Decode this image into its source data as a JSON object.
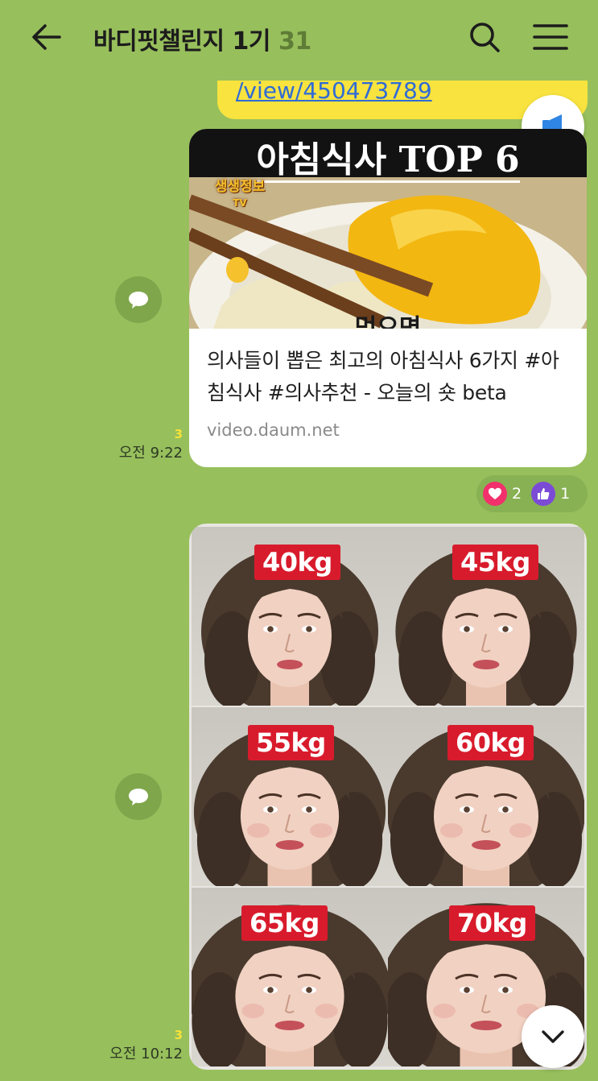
{
  "header": {
    "title": "바디핏챌린지 1기",
    "member_count": "31",
    "back_icon": "arrow-left-icon",
    "search_icon": "search-icon",
    "menu_icon": "hamburger-menu-icon"
  },
  "previous_message": {
    "link_text": "/view/450473789"
  },
  "notice_icon": "megaphone-icon",
  "link_message": {
    "thumbnail": {
      "title": "아침식사 TOP 6",
      "brand": "생생정보",
      "brand_sub": "TV",
      "caption": "먹으면"
    },
    "title": "의사들이 뽑은 최고의 아침식사 6가지 #아침식사 #의사추천 - 오늘의 숏 beta",
    "domain": "video.daum.net",
    "unread": "3",
    "time": "오전 9:22",
    "reactions": [
      {
        "icon": "heart-icon",
        "count": "2",
        "color": "#f1306c"
      },
      {
        "icon": "thumbs-up-icon",
        "count": "1",
        "color": "#7b4bd6"
      }
    ]
  },
  "image_message": {
    "tiles": [
      {
        "label": "40kg",
        "face_width": 0.0
      },
      {
        "label": "45kg",
        "face_width": 0.1
      },
      {
        "label": "55kg",
        "face_width": 0.35
      },
      {
        "label": "60kg",
        "face_width": 0.5
      },
      {
        "label": "65kg",
        "face_width": 0.6
      },
      {
        "label": "70kg",
        "face_width": 0.85
      }
    ],
    "unread": "3",
    "time": "오전 10:12"
  },
  "colors": {
    "chat_background": "#97bf5c",
    "my_bubble": "#f8e33f",
    "tag_red": "#d81b2c"
  },
  "share_icon": "share-bubble-icon",
  "scroll_down_icon": "chevron-down-icon"
}
